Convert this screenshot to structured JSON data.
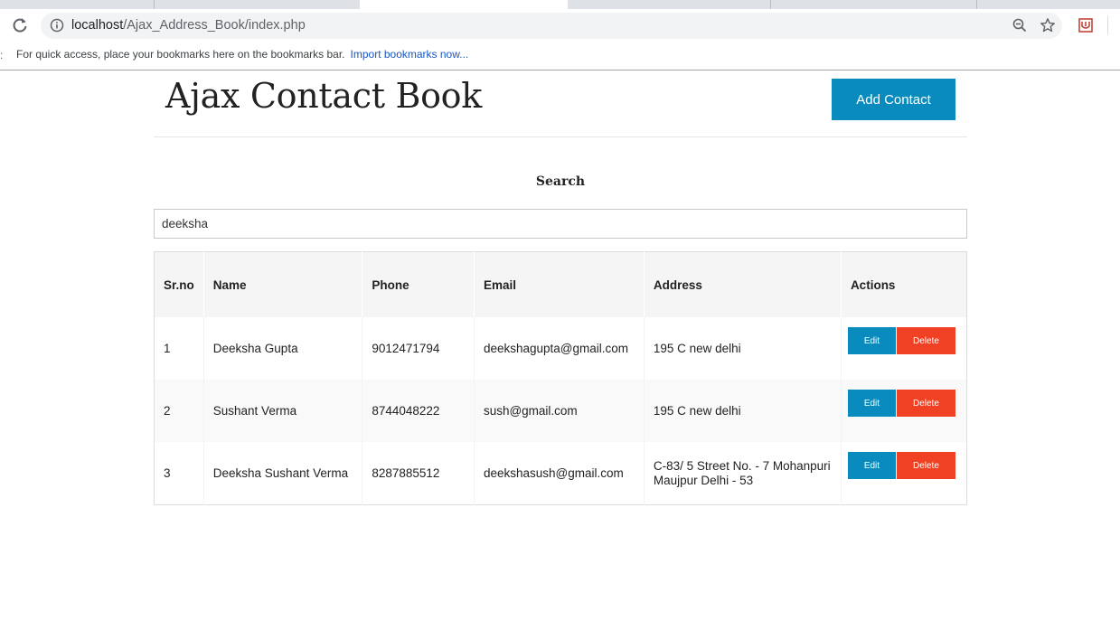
{
  "browser": {
    "url_host": "localhost",
    "url_path": "/Ajax_Address_Book/index.php",
    "bookmarks_text": "For quick access, place your bookmarks here on the bookmarks bar.",
    "bookmarks_link": "Import bookmarks now..."
  },
  "header": {
    "title": "Ajax Contact Book",
    "add_label": "Add Contact"
  },
  "search": {
    "label": "Search",
    "value": "deeksha"
  },
  "table": {
    "columns": [
      "Sr.no",
      "Name",
      "Phone",
      "Email",
      "Address",
      "Actions"
    ],
    "rows": [
      {
        "sr": "1",
        "name": "Deeksha Gupta",
        "phone": "9012471794",
        "email": "deekshagupta@gmail.com",
        "address": "195 C new delhi",
        "edit": "Edit",
        "delete": "Delete"
      },
      {
        "sr": "2",
        "name": "Sushant Verma",
        "phone": "8744048222",
        "email": "sush@gmail.com",
        "address": "195 C new delhi",
        "edit": "Edit",
        "delete": "Delete"
      },
      {
        "sr": "3",
        "name": "Deeksha Sushant Verma",
        "phone": "8287885512",
        "email": "deekshasush@gmail.com",
        "address": "C-83/ 5 Street No. - 7 Mohanpuri Maujpur Delhi - 53",
        "edit": "Edit",
        "delete": "Delete"
      }
    ]
  },
  "colors": {
    "primary": "#0a8bbd",
    "danger": "#f04124"
  }
}
